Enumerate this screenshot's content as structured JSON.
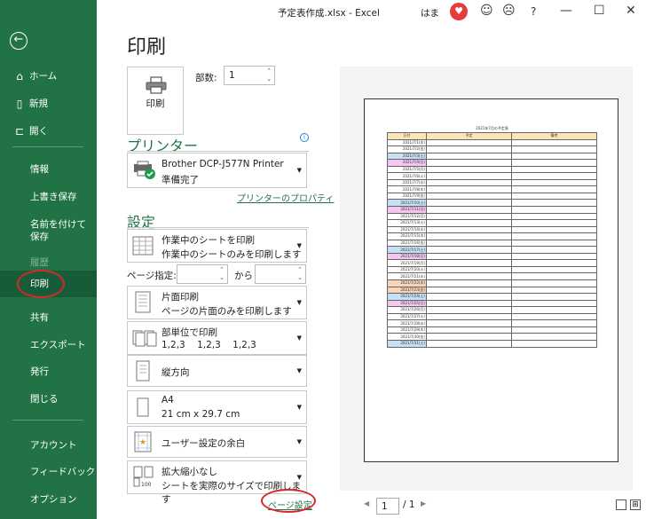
{
  "window": {
    "title": "予定表作成.xlsx - Excel",
    "user": "はま"
  },
  "sidebar": {
    "items": [
      {
        "label": "ホーム",
        "icon": "home-icon"
      },
      {
        "label": "新規",
        "icon": "new-document-icon"
      },
      {
        "label": "開く",
        "icon": "open-folder-icon"
      },
      {
        "label": "情報"
      },
      {
        "label": "上書き保存"
      },
      {
        "label": "名前を付けて保存"
      },
      {
        "label": "履歴"
      },
      {
        "label": "印刷"
      },
      {
        "label": "共有"
      },
      {
        "label": "エクスポート"
      },
      {
        "label": "発行"
      },
      {
        "label": "閉じる"
      },
      {
        "label": "アカウント"
      },
      {
        "label": "フィードバック"
      },
      {
        "label": "オプション"
      }
    ]
  },
  "page": {
    "title": "印刷"
  },
  "print": {
    "button_label": "印刷",
    "copies_label": "部数:",
    "copies_value": "1"
  },
  "printer": {
    "heading": "プリンター",
    "name": "Brother DCP-J577N Printer",
    "status": "準備完了",
    "properties_link": "プリンターのプロパティ"
  },
  "settings": {
    "heading": "設定",
    "what": {
      "line1": "作業中のシートを印刷",
      "line2": "作業中のシートのみを印刷します"
    },
    "pages_label": "ページ指定:",
    "pages_to": "から",
    "sides": {
      "line1": "片面印刷",
      "line2": "ページの片面のみを印刷します"
    },
    "collate": {
      "line1": "部単位で印刷",
      "line2": "1,2,3    1,2,3    1,2,3"
    },
    "orientation": {
      "line1": "縦方向"
    },
    "paper": {
      "line1": "A4",
      "line2": "21 cm x 29.7 cm"
    },
    "margins": {
      "line1": "ユーザー設定の余白"
    },
    "scaling": {
      "line1": "拡大縮小なし",
      "line2": "シートを実際のサイズで印刷します"
    },
    "page_setup_link": "ページ設定"
  },
  "preview": {
    "sheet_title": "2021年7月の予定表",
    "headers": [
      "日付",
      "予定",
      "備考"
    ],
    "rows": [
      {
        "date": "2021/7/1(木)",
        "color": "#ffffff"
      },
      {
        "date": "2021/7/2(金)",
        "color": "#ffffff"
      },
      {
        "date": "2021/7/3(土)",
        "color": "#c6e0f4"
      },
      {
        "date": "2021/7/4(日)",
        "color": "#f4c6f0"
      },
      {
        "date": "2021/7/5(月)",
        "color": "#ffffff"
      },
      {
        "date": "2021/7/6(火)",
        "color": "#ffffff"
      },
      {
        "date": "2021/7/7(水)",
        "color": "#ffffff"
      },
      {
        "date": "2021/7/8(木)",
        "color": "#ffffff"
      },
      {
        "date": "2021/7/9(金)",
        "color": "#ffffff"
      },
      {
        "date": "2021/7/10(土)",
        "color": "#c6e0f4"
      },
      {
        "date": "2021/7/11(日)",
        "color": "#f4c6f0"
      },
      {
        "date": "2021/7/12(月)",
        "color": "#ffffff"
      },
      {
        "date": "2021/7/13(火)",
        "color": "#ffffff"
      },
      {
        "date": "2021/7/14(水)",
        "color": "#ffffff"
      },
      {
        "date": "2021/7/15(木)",
        "color": "#ffffff"
      },
      {
        "date": "2021/7/16(金)",
        "color": "#ffffff"
      },
      {
        "date": "2021/7/17(土)",
        "color": "#c6e0f4"
      },
      {
        "date": "2021/7/18(日)",
        "color": "#f4c6f0"
      },
      {
        "date": "2021/7/19(月)",
        "color": "#ffffff"
      },
      {
        "date": "2021/7/20(火)",
        "color": "#ffffff"
      },
      {
        "date": "2021/7/21(水)",
        "color": "#ffffff"
      },
      {
        "date": "2021/7/22(木)",
        "color": "#f8d4b8"
      },
      {
        "date": "2021/7/23(金)",
        "color": "#f8d4b8"
      },
      {
        "date": "2021/7/24(土)",
        "color": "#c6e0f4"
      },
      {
        "date": "2021/7/25(日)",
        "color": "#f4c6f0"
      },
      {
        "date": "2021/7/26(月)",
        "color": "#ffffff"
      },
      {
        "date": "2021/7/27(火)",
        "color": "#ffffff"
      },
      {
        "date": "2021/7/28(水)",
        "color": "#ffffff"
      },
      {
        "date": "2021/7/29(木)",
        "color": "#ffffff"
      },
      {
        "date": "2021/7/30(金)",
        "color": "#ffffff"
      },
      {
        "date": "2021/7/31(土)",
        "color": "#c6e0f4"
      }
    ],
    "header_color": "#fbe5b6"
  },
  "pager": {
    "current": "1",
    "total": "/ 1"
  },
  "colors": {
    "accent": "#217346",
    "highlight_circle": "#d8262d"
  }
}
